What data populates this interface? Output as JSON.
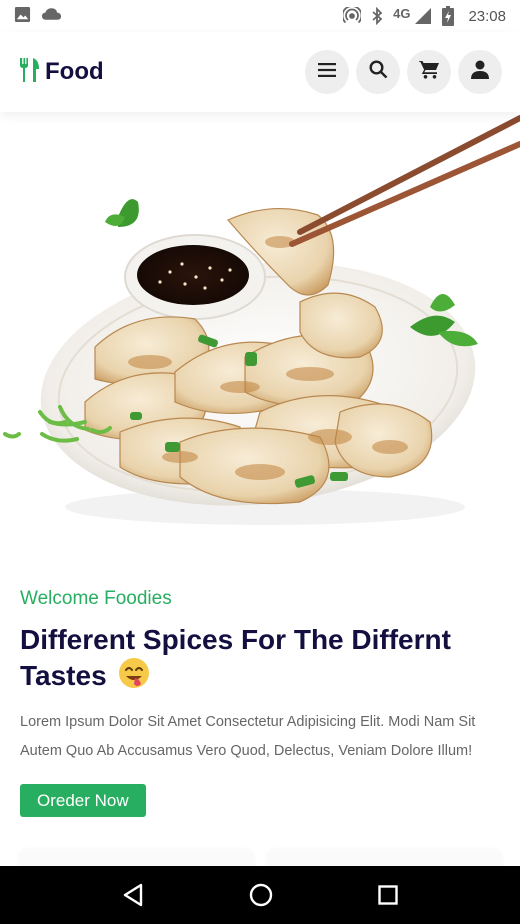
{
  "status_bar": {
    "time": "23:08",
    "network_type": "4G",
    "icons": [
      "image-icon",
      "cloud-icon",
      "hotspot-icon",
      "bluetooth-icon",
      "signal-icon",
      "battery-charging-icon"
    ]
  },
  "header": {
    "logo_text": "Food",
    "logo_icon": "fork-spoon-icon",
    "actions": [
      "menu-icon",
      "search-icon",
      "cart-icon",
      "user-icon"
    ]
  },
  "hero": {
    "image": "dumplings-with-chopsticks-and-soy-sauce"
  },
  "main": {
    "subtitle": "Welcome Foodies",
    "title": "Different Spices For The Differnt Tastes",
    "emoji": "😋",
    "description": "Lorem Ipsum Dolor Sit Amet Consectetur Adipisicing Elit. Modi Nam Sit Autem Quo Ab Accusamus Vero Quod, Delectus, Veniam Dolore Illum!",
    "cta_label": "Oreder Now"
  },
  "colors": {
    "accent": "#27ae60",
    "heading": "#130f40",
    "text": "#666666",
    "icon_bg": "#eeeeee"
  },
  "navigation_bar": [
    "back-icon",
    "home-icon",
    "recents-icon"
  ]
}
